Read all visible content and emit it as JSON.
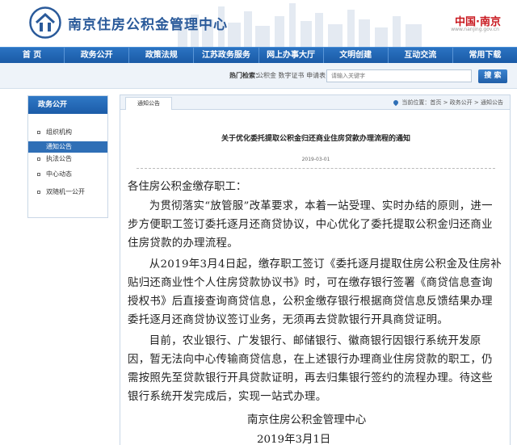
{
  "header": {
    "site_title": "南京住房公积金管理中心",
    "china_nanjing": "中国·南京",
    "china_nanjing_url": "www.nanjing.gov.cn"
  },
  "nav": {
    "items": [
      "首 页",
      "政务公开",
      "政策法规",
      "江苏政务服务",
      "网上办事大厅",
      "文明创建",
      "互动交流",
      "常用下载"
    ]
  },
  "search": {
    "hot_label": "热门检索：",
    "hot_words": "公积金  数字证书  申请表",
    "placeholder": "请输入关键字",
    "button_label": "搜 索"
  },
  "sidebar": {
    "title": "政务公开",
    "items": [
      {
        "label": "组织机构",
        "active": false
      },
      {
        "label": "通知公告",
        "active": true
      },
      {
        "label": "执法公告",
        "active": false
      },
      {
        "label": "中心动态",
        "active": false
      },
      {
        "label": "双随机一公开",
        "active": false
      }
    ]
  },
  "content": {
    "tab_label": "通知公告",
    "breadcrumb": "当前位置：首页 > 政务公开 > 通知公告",
    "article_title": "关于优化委托提取公积金归还商业住房贷款办理流程的通知",
    "article_date": "2019-03-01",
    "salutation": "各住房公积金缴存职工：",
    "paragraphs": [
      "为贯彻落实“放管服”改革要求，本着一站受理、实时办结的原则，进一步方便职工签订委托逐月还商贷协议，中心优化了委托提取公积金归还商业住房贷款的办理流程。",
      "从2019年3月4日起，缴存职工签订《委托逐月提取住房公积金及住房补贴归还商业性个人住房贷款协议书》时，可在缴存银行签署《商贷信息查询授权书》后直接查询商贷信息，公积金缴存银行根据商贷信息反馈结果办理委托逐月还商贷协议签订业务，无须再去贷款银行开具商贷证明。",
      "目前，农业银行、广发银行、邮储银行、徽商银行因银行系统开发原因，暂无法向中心传输商贷信息，在上述银行办理商业住房贷款的职工，仍需按照先至贷款银行开具贷款证明，再去归集银行签约的流程办理。待这些银行系统开发完成后，实现一站式办理。"
    ],
    "signature": "南京住房公积金管理中心",
    "sign_date": "2019年3月1日"
  },
  "colors": {
    "brand_blue": "#1a5aa6",
    "title_blue": "#2a5a9a",
    "china_red": "#c8161d"
  }
}
